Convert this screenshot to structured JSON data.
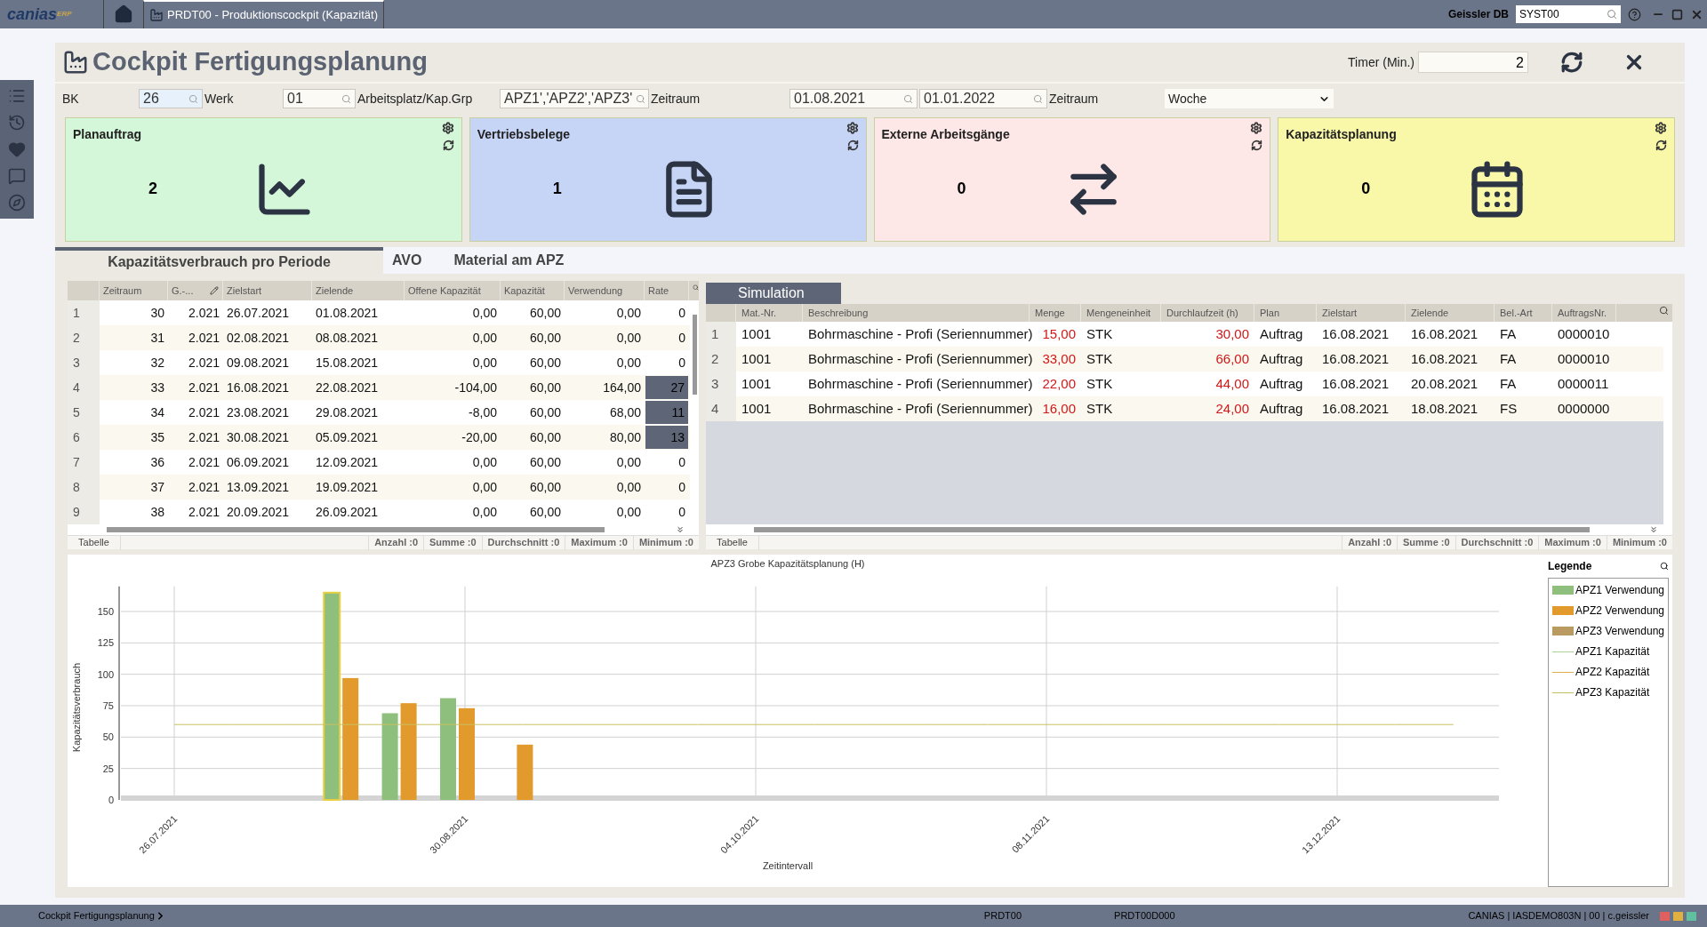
{
  "app_bar": {
    "logo": "canias",
    "logo_sup": "ERP",
    "tab": "PRDT00 - Produktionscockpit (Kapazität)",
    "db_label": "Geissler DB",
    "db_value": "SYST00"
  },
  "header": {
    "title": "Cockpit Fertigungsplanung",
    "timer_label": "Timer (Min.)",
    "timer_value": "2"
  },
  "filters": [
    {
      "label": "BK",
      "fields": [
        {
          "value": "26",
          "kind": "search",
          "focused": true
        }
      ]
    },
    {
      "label": "Werk",
      "fields": [
        {
          "value": "01",
          "kind": "search",
          "focused": false
        }
      ]
    },
    {
      "label": "Arbeitsplatz/Kap.Grp",
      "fields": [
        {
          "value": "APZ1','APZ2','APZ3'",
          "kind": "search",
          "focused": false
        }
      ]
    },
    {
      "label": "Zeitraum",
      "fields": [
        {
          "value": "01.08.2021",
          "kind": "search",
          "focused": false
        },
        {
          "value": "01.01.2022",
          "kind": "search",
          "focused": false
        }
      ]
    },
    {
      "label": "Zeitraum",
      "fields": [
        {
          "value": "Woche",
          "kind": "select",
          "focused": false
        }
      ]
    }
  ],
  "cards": [
    {
      "title": "Planauftrag",
      "count": "2",
      "color": "#d4f6d9"
    },
    {
      "title": "Vertriebsbelege",
      "count": "1",
      "color": "#c6d4f6"
    },
    {
      "title": "Externe Arbeitsgänge",
      "count": "0",
      "color": "#fde7e7"
    },
    {
      "title": "Kapazitätsplanung",
      "count": "0",
      "color": "#f8f8a8"
    }
  ],
  "tabs": [
    {
      "label": "Kapazitätsverbrauch pro Periode",
      "selected": true
    },
    {
      "label": "AVO",
      "selected": false
    },
    {
      "label": "Material am APZ",
      "selected": false
    }
  ],
  "period_table": {
    "columns": [
      "Zeitraum",
      "G.-...",
      "Zielstart",
      "Zielende",
      "Offene Kapazität",
      "Kapazität",
      "Verwendung",
      "Rate"
    ],
    "rows": [
      {
        "num": "1",
        "cells": [
          "30",
          "2.021",
          "26.07.2021",
          "01.08.2021",
          "0,00",
          "60,00",
          "0,00",
          "0"
        ],
        "overloaded": false
      },
      {
        "num": "2",
        "cells": [
          "31",
          "2.021",
          "02.08.2021",
          "08.08.2021",
          "0,00",
          "60,00",
          "0,00",
          "0"
        ],
        "overloaded": false
      },
      {
        "num": "3",
        "cells": [
          "32",
          "2.021",
          "09.08.2021",
          "15.08.2021",
          "0,00",
          "60,00",
          "0,00",
          "0"
        ],
        "overloaded": false
      },
      {
        "num": "4",
        "cells": [
          "33",
          "2.021",
          "16.08.2021",
          "22.08.2021",
          "-104,00",
          "60,00",
          "164,00",
          "27"
        ],
        "overloaded": true
      },
      {
        "num": "5",
        "cells": [
          "34",
          "2.021",
          "23.08.2021",
          "29.08.2021",
          "-8,00",
          "60,00",
          "68,00",
          "11"
        ],
        "overloaded": true
      },
      {
        "num": "6",
        "cells": [
          "35",
          "2.021",
          "30.08.2021",
          "05.09.2021",
          "-20,00",
          "60,00",
          "80,00",
          "13"
        ],
        "overloaded": true
      },
      {
        "num": "7",
        "cells": [
          "36",
          "2.021",
          "06.09.2021",
          "12.09.2021",
          "0,00",
          "60,00",
          "0,00",
          "0"
        ],
        "overloaded": false
      },
      {
        "num": "8",
        "cells": [
          "37",
          "2.021",
          "13.09.2021",
          "19.09.2021",
          "0,00",
          "60,00",
          "0,00",
          "0"
        ],
        "overloaded": false
      },
      {
        "num": "9",
        "cells": [
          "38",
          "2.021",
          "20.09.2021",
          "26.09.2021",
          "0,00",
          "60,00",
          "0,00",
          "0"
        ],
        "overloaded": false
      }
    ],
    "footer_label": "Tabelle",
    "stats": [
      "Anzahl :0",
      "Summe :0",
      "Durchschnitt :0",
      "Maximum :0",
      "Minimum :0"
    ]
  },
  "simulation": {
    "title": "Simulation",
    "columns": [
      {
        "label": "Mat.-Nr.",
        "highlight": false
      },
      {
        "label": "Beschreibung",
        "highlight": false
      },
      {
        "label": "Menge",
        "highlight": true
      },
      {
        "label": "Mengeneinheit",
        "highlight": false
      },
      {
        "label": "Durchlaufzeit (h)",
        "highlight": true
      },
      {
        "label": "Plan",
        "highlight": false
      },
      {
        "label": "Zielstart",
        "highlight": false
      },
      {
        "label": "Zielende",
        "highlight": false
      },
      {
        "label": "Bel.-Art",
        "highlight": false
      },
      {
        "label": "AuftragsNr.",
        "highlight": false
      }
    ],
    "rows": [
      {
        "num": "1",
        "cells": [
          "1001",
          "Bohrmaschine - Profi (Seriennummer)",
          "15,00",
          "STK",
          "30,00",
          "Auftrag",
          "16.08.2021",
          "16.08.2021",
          "FA",
          "0000010"
        ]
      },
      {
        "num": "2",
        "cells": [
          "1001",
          "Bohrmaschine - Profi (Seriennummer)",
          "33,00",
          "STK",
          "66,00",
          "Auftrag",
          "16.08.2021",
          "16.08.2021",
          "FA",
          "0000010"
        ]
      },
      {
        "num": "3",
        "cells": [
          "1001",
          "Bohrmaschine - Profi (Seriennummer)",
          "22,00",
          "STK",
          "44,00",
          "Auftrag",
          "16.08.2021",
          "20.08.2021",
          "FA",
          "0000011"
        ]
      },
      {
        "num": "4",
        "cells": [
          "1001",
          "Bohrmaschine - Profi (Seriennummer)",
          "16,00",
          "STK",
          "24,00",
          "Auftrag",
          "16.08.2021",
          "18.08.2021",
          "FS",
          "0000000"
        ]
      }
    ],
    "footer_label": "Tabelle",
    "stats": [
      "Anzahl :0",
      "Summe :0",
      "Durchschnitt :0",
      "Maximum :0",
      "Minimum :0"
    ]
  },
  "chart": {
    "legend_title": "Legende",
    "chart_data": {
      "type": "bar",
      "title": "APZ3 Grobe Kapazitätsplanung (H)",
      "xlabel": "Zeitintervall",
      "ylabel": "Kapazitätsverbrauch",
      "categories": [
        "26.07.2021",
        null,
        null,
        null,
        null,
        "30.08.2021",
        null,
        null,
        null,
        null,
        "04.10.2021",
        null,
        null,
        null,
        null,
        "08.11.2021",
        null,
        null,
        null,
        null,
        "13.12.2021",
        null,
        null
      ],
      "series": [
        {
          "name": "APZ1 Verwendung",
          "color": "#8fbf7c",
          "type": "bar",
          "values": [
            null,
            null,
            null,
            165,
            69,
            81,
            null,
            null,
            null,
            null,
            null,
            null,
            null,
            null,
            null,
            null,
            null,
            null,
            null,
            null,
            null,
            null,
            null
          ]
        },
        {
          "name": "APZ2 Verwendung",
          "color": "#e29a2c",
          "type": "bar",
          "values": [
            null,
            null,
            null,
            97,
            77,
            73,
            44,
            null,
            null,
            null,
            null,
            null,
            null,
            null,
            null,
            null,
            null,
            null,
            null,
            null,
            null,
            null,
            null
          ]
        },
        {
          "name": "APZ3 Verwendung",
          "color": "#b99b62",
          "type": "bar",
          "values": [
            null,
            null,
            null,
            null,
            null,
            null,
            null,
            null,
            null,
            null,
            null,
            null,
            null,
            null,
            null,
            null,
            null,
            null,
            null,
            null,
            null,
            null,
            null
          ]
        },
        {
          "name": "APZ1 Kapazität",
          "color": "#a8d49a",
          "type": "line",
          "values": [
            null,
            null,
            null,
            null,
            null,
            null,
            null,
            null,
            null,
            null,
            null,
            null,
            null,
            null,
            null,
            null,
            null,
            null,
            null,
            null,
            null,
            null,
            null
          ]
        },
        {
          "name": "APZ2 Kapazität",
          "color": "#e0b050",
          "type": "line",
          "values": [
            null,
            null,
            null,
            null,
            null,
            null,
            null,
            null,
            null,
            null,
            null,
            null,
            null,
            null,
            null,
            null,
            null,
            null,
            null,
            null,
            null,
            null,
            null
          ]
        },
        {
          "name": "APZ3 Kapazität",
          "color": "#c8c060",
          "type": "line",
          "values": [
            60,
            60,
            60,
            60,
            60,
            60,
            60,
            60,
            60,
            60,
            60,
            60,
            60,
            60,
            60,
            60,
            60,
            60,
            60,
            60,
            60,
            60,
            60
          ]
        }
      ],
      "ylim": [
        0,
        170
      ],
      "grid": true,
      "yticks": [
        0,
        25,
        50,
        75,
        100,
        125,
        150
      ]
    }
  },
  "status_bar": {
    "breadcrumb": "Cockpit Fertigungsplanung",
    "items": [
      "PRDT00",
      "PRDT00D000"
    ],
    "user": "CANIAS | IASDEMO803N | 00 | c.geissler"
  }
}
